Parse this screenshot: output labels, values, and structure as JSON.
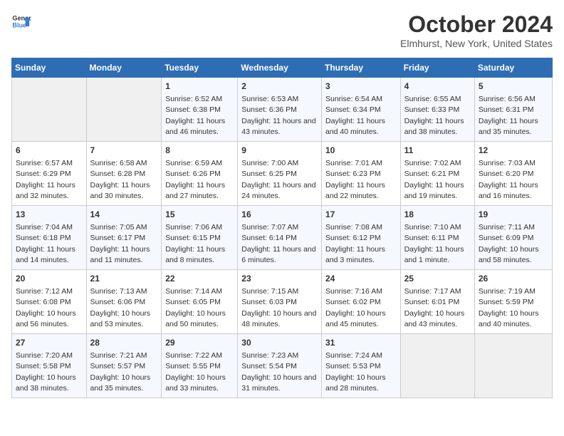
{
  "header": {
    "logo_line1": "General",
    "logo_line2": "Blue",
    "month": "October 2024",
    "location": "Elmhurst, New York, United States"
  },
  "weekdays": [
    "Sunday",
    "Monday",
    "Tuesday",
    "Wednesday",
    "Thursday",
    "Friday",
    "Saturday"
  ],
  "weeks": [
    [
      {
        "day": "",
        "sunrise": "",
        "sunset": "",
        "daylight": "",
        "empty": true
      },
      {
        "day": "",
        "sunrise": "",
        "sunset": "",
        "daylight": "",
        "empty": true
      },
      {
        "day": "1",
        "sunrise": "Sunrise: 6:52 AM",
        "sunset": "Sunset: 6:38 PM",
        "daylight": "Daylight: 11 hours and 46 minutes."
      },
      {
        "day": "2",
        "sunrise": "Sunrise: 6:53 AM",
        "sunset": "Sunset: 6:36 PM",
        "daylight": "Daylight: 11 hours and 43 minutes."
      },
      {
        "day": "3",
        "sunrise": "Sunrise: 6:54 AM",
        "sunset": "Sunset: 6:34 PM",
        "daylight": "Daylight: 11 hours and 40 minutes."
      },
      {
        "day": "4",
        "sunrise": "Sunrise: 6:55 AM",
        "sunset": "Sunset: 6:33 PM",
        "daylight": "Daylight: 11 hours and 38 minutes."
      },
      {
        "day": "5",
        "sunrise": "Sunrise: 6:56 AM",
        "sunset": "Sunset: 6:31 PM",
        "daylight": "Daylight: 11 hours and 35 minutes."
      }
    ],
    [
      {
        "day": "6",
        "sunrise": "Sunrise: 6:57 AM",
        "sunset": "Sunset: 6:29 PM",
        "daylight": "Daylight: 11 hours and 32 minutes."
      },
      {
        "day": "7",
        "sunrise": "Sunrise: 6:58 AM",
        "sunset": "Sunset: 6:28 PM",
        "daylight": "Daylight: 11 hours and 30 minutes."
      },
      {
        "day": "8",
        "sunrise": "Sunrise: 6:59 AM",
        "sunset": "Sunset: 6:26 PM",
        "daylight": "Daylight: 11 hours and 27 minutes."
      },
      {
        "day": "9",
        "sunrise": "Sunrise: 7:00 AM",
        "sunset": "Sunset: 6:25 PM",
        "daylight": "Daylight: 11 hours and 24 minutes."
      },
      {
        "day": "10",
        "sunrise": "Sunrise: 7:01 AM",
        "sunset": "Sunset: 6:23 PM",
        "daylight": "Daylight: 11 hours and 22 minutes."
      },
      {
        "day": "11",
        "sunrise": "Sunrise: 7:02 AM",
        "sunset": "Sunset: 6:21 PM",
        "daylight": "Daylight: 11 hours and 19 minutes."
      },
      {
        "day": "12",
        "sunrise": "Sunrise: 7:03 AM",
        "sunset": "Sunset: 6:20 PM",
        "daylight": "Daylight: 11 hours and 16 minutes."
      }
    ],
    [
      {
        "day": "13",
        "sunrise": "Sunrise: 7:04 AM",
        "sunset": "Sunset: 6:18 PM",
        "daylight": "Daylight: 11 hours and 14 minutes."
      },
      {
        "day": "14",
        "sunrise": "Sunrise: 7:05 AM",
        "sunset": "Sunset: 6:17 PM",
        "daylight": "Daylight: 11 hours and 11 minutes."
      },
      {
        "day": "15",
        "sunrise": "Sunrise: 7:06 AM",
        "sunset": "Sunset: 6:15 PM",
        "daylight": "Daylight: 11 hours and 8 minutes."
      },
      {
        "day": "16",
        "sunrise": "Sunrise: 7:07 AM",
        "sunset": "Sunset: 6:14 PM",
        "daylight": "Daylight: 11 hours and 6 minutes."
      },
      {
        "day": "17",
        "sunrise": "Sunrise: 7:08 AM",
        "sunset": "Sunset: 6:12 PM",
        "daylight": "Daylight: 11 hours and 3 minutes."
      },
      {
        "day": "18",
        "sunrise": "Sunrise: 7:10 AM",
        "sunset": "Sunset: 6:11 PM",
        "daylight": "Daylight: 11 hours and 1 minute."
      },
      {
        "day": "19",
        "sunrise": "Sunrise: 7:11 AM",
        "sunset": "Sunset: 6:09 PM",
        "daylight": "Daylight: 10 hours and 58 minutes."
      }
    ],
    [
      {
        "day": "20",
        "sunrise": "Sunrise: 7:12 AM",
        "sunset": "Sunset: 6:08 PM",
        "daylight": "Daylight: 10 hours and 56 minutes."
      },
      {
        "day": "21",
        "sunrise": "Sunrise: 7:13 AM",
        "sunset": "Sunset: 6:06 PM",
        "daylight": "Daylight: 10 hours and 53 minutes."
      },
      {
        "day": "22",
        "sunrise": "Sunrise: 7:14 AM",
        "sunset": "Sunset: 6:05 PM",
        "daylight": "Daylight: 10 hours and 50 minutes."
      },
      {
        "day": "23",
        "sunrise": "Sunrise: 7:15 AM",
        "sunset": "Sunset: 6:03 PM",
        "daylight": "Daylight: 10 hours and 48 minutes."
      },
      {
        "day": "24",
        "sunrise": "Sunrise: 7:16 AM",
        "sunset": "Sunset: 6:02 PM",
        "daylight": "Daylight: 10 hours and 45 minutes."
      },
      {
        "day": "25",
        "sunrise": "Sunrise: 7:17 AM",
        "sunset": "Sunset: 6:01 PM",
        "daylight": "Daylight: 10 hours and 43 minutes."
      },
      {
        "day": "26",
        "sunrise": "Sunrise: 7:19 AM",
        "sunset": "Sunset: 5:59 PM",
        "daylight": "Daylight: 10 hours and 40 minutes."
      }
    ],
    [
      {
        "day": "27",
        "sunrise": "Sunrise: 7:20 AM",
        "sunset": "Sunset: 5:58 PM",
        "daylight": "Daylight: 10 hours and 38 minutes."
      },
      {
        "day": "28",
        "sunrise": "Sunrise: 7:21 AM",
        "sunset": "Sunset: 5:57 PM",
        "daylight": "Daylight: 10 hours and 35 minutes."
      },
      {
        "day": "29",
        "sunrise": "Sunrise: 7:22 AM",
        "sunset": "Sunset: 5:55 PM",
        "daylight": "Daylight: 10 hours and 33 minutes."
      },
      {
        "day": "30",
        "sunrise": "Sunrise: 7:23 AM",
        "sunset": "Sunset: 5:54 PM",
        "daylight": "Daylight: 10 hours and 31 minutes."
      },
      {
        "day": "31",
        "sunrise": "Sunrise: 7:24 AM",
        "sunset": "Sunset: 5:53 PM",
        "daylight": "Daylight: 10 hours and 28 minutes."
      },
      {
        "day": "",
        "sunrise": "",
        "sunset": "",
        "daylight": "",
        "empty": true
      },
      {
        "day": "",
        "sunrise": "",
        "sunset": "",
        "daylight": "",
        "empty": true
      }
    ]
  ]
}
